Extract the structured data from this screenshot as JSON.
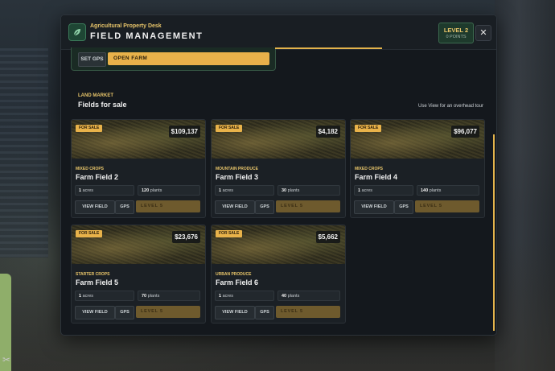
{
  "header": {
    "kicker": "Agricultural Property Desk",
    "title": "FIELD MANAGEMENT",
    "level": "LEVEL 2",
    "points": "0 POINTS",
    "close": "✕"
  },
  "top_actions": {
    "set_gps": "SET GPS",
    "open_farm": "OPEN FARM"
  },
  "section": {
    "kicker": "LAND MARKET",
    "title": "Fields for sale",
    "hint": "Use View for an overhead tour"
  },
  "colors": {
    "accent": "#e8b24a",
    "kicker": "#e8c56a",
    "panel": "#14181d"
  },
  "cards": [
    {
      "tag": "FOR SALE",
      "price": "$109,137",
      "category": "MIXED CROPS",
      "name": "Farm Field 2",
      "acres": "1",
      "acres_unit": "acres",
      "plants": "120",
      "plants_unit": "plants",
      "view": "VIEW FIELD",
      "gps": "GPS",
      "level": "LEVEL 5"
    },
    {
      "tag": "FOR SALE",
      "price": "$4,182",
      "category": "MOUNTAIN PRODUCE",
      "name": "Farm Field 3",
      "acres": "1",
      "acres_unit": "acres",
      "plants": "30",
      "plants_unit": "plants",
      "view": "VIEW FIELD",
      "gps": "GPS",
      "level": "LEVEL 5"
    },
    {
      "tag": "FOR SALE",
      "price": "$96,077",
      "category": "MIXED CROPS",
      "name": "Farm Field 4",
      "acres": "1",
      "acres_unit": "acres",
      "plants": "140",
      "plants_unit": "plants",
      "view": "VIEW FIELD",
      "gps": "GPS",
      "level": "LEVEL 5"
    },
    {
      "tag": "FOR SALE",
      "price": "$23,676",
      "category": "STARTER CROPS",
      "name": "Farm Field 5",
      "acres": "1",
      "acres_unit": "acres",
      "plants": "70",
      "plants_unit": "plants",
      "view": "VIEW FIELD",
      "gps": "GPS",
      "level": "LEVEL 5"
    },
    {
      "tag": "FOR SALE",
      "price": "$5,662",
      "category": "URBAN PRODUCE",
      "name": "Farm Field 6",
      "acres": "1",
      "acres_unit": "acres",
      "plants": "40",
      "plants_unit": "plants",
      "view": "VIEW FIELD",
      "gps": "GPS",
      "level": "LEVEL 5"
    }
  ]
}
